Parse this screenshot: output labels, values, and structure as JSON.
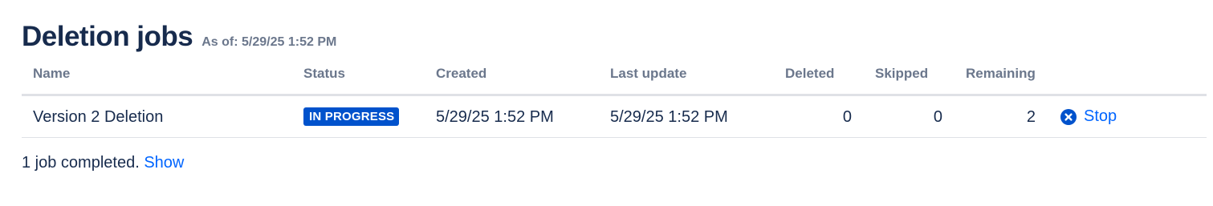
{
  "header": {
    "title": "Deletion jobs",
    "as_of": "As of: 5/29/25 1:52 PM"
  },
  "table": {
    "columns": {
      "name": "Name",
      "status": "Status",
      "created": "Created",
      "last_update": "Last update",
      "deleted": "Deleted",
      "skipped": "Skipped",
      "remaining": "Remaining"
    },
    "rows": [
      {
        "name": "Version 2 Deletion",
        "status": "IN PROGRESS",
        "created": "5/29/25 1:52 PM",
        "last_update": "5/29/25 1:52 PM",
        "deleted": "0",
        "skipped": "0",
        "remaining": "2",
        "action": "Stop",
        "action_icon": "close-circle-icon"
      }
    ]
  },
  "footer": {
    "text": "1 job completed.",
    "link": "Show"
  },
  "colors": {
    "title": "#172b4d",
    "muted": "#6b778c",
    "lozenge_bg": "#0052cc",
    "link": "#0065ff",
    "divider": "#dfe1e6"
  }
}
